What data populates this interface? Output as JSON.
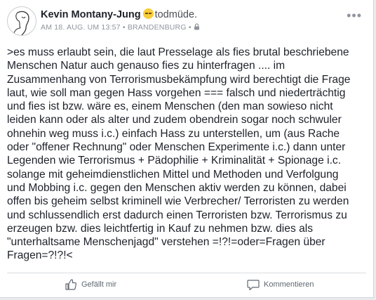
{
  "post": {
    "author": "Kevin Montany-Jung",
    "feeling": "todmüde.",
    "meta": "AM 18. AUG. UM 13:57 • BRANDENBURG •",
    "lines": [
      ">es muss erlaubt sein, die laut Presselage als fies brutal beschriebene",
      "Menschen Natur auch genauso fies zu hinterfragen ....  im",
      "Zusammenhang von  Terrorismusbekämpfung wird berechtigt die Frage",
      "laut, wie soll man gegen Hass vorgehen === falsch und niederträchtig",
      "und fies ist bzw. wäre es, einem Menschen (den man sowieso nicht",
      "leiden kann oder als alter und zudem obendrein sogar noch schwuler",
      "ohnehin weg muss i.c.)  einfach Hass zu unterstellen, um (aus Rache",
      "oder \"offener Rechnung\" oder Menschen Experimente i.c.) dann unter",
      "Legenden wie Terrorismus + Pädophilie + Kriminalität + Spionage i.c.",
      "solange mit geheimdienstlichen Mittel und Methoden und Verfolgung",
      "und Mobbing i.c.  gegen den Menschen aktiv  werden zu können, dabei",
      "offen bis geheim selbst kriminell wie Verbrecher/ Terroristen zu werden",
      "und schlussendlich erst dadurch einen Terroristen bzw. Terrorismus zu",
      "erzeugen bzw. dies leichtfertig in Kauf zu nehmen bzw. dies als",
      "\"unterhaltsame  Menschenjagd\" verstehen  =!?!=oder=Fragen über",
      "Fragen=?!?!<"
    ]
  },
  "actions": {
    "like_label": "Gefällt mir",
    "comment_label": "Kommentieren"
  },
  "icons": {
    "more": "more-icon",
    "lock": "lock-icon",
    "like": "thumbs-up-icon",
    "comment": "comment-icon"
  }
}
